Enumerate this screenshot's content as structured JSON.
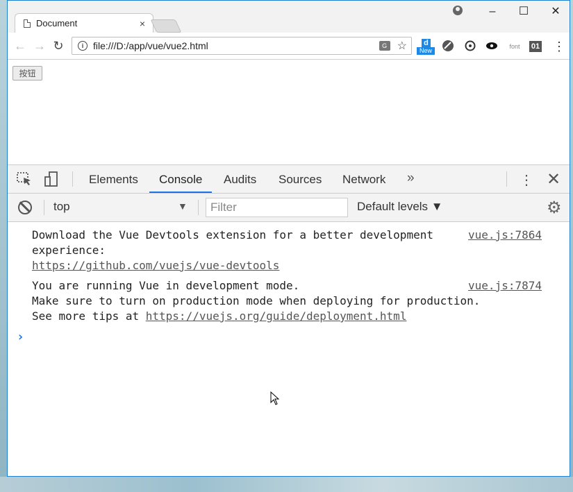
{
  "window": {
    "tab_title": "Document",
    "tab_close": "×",
    "minimize": "–",
    "maximize": "☐",
    "close": "✕"
  },
  "toolbar": {
    "back": "←",
    "forward": "→",
    "reload": "↻",
    "info": "i",
    "url": "file:///D:/app/vue/vue2.html",
    "translate": "G",
    "star": "☆",
    "ext_new_label": "New",
    "ext_d": "d",
    "ext_font": "font",
    "ext_01": "01",
    "menu": "⋮"
  },
  "page": {
    "button_label": "按钮"
  },
  "devtools": {
    "tabs": [
      "Elements",
      "Console",
      "Audits",
      "Sources",
      "Network"
    ],
    "active_tab": "Console",
    "more": "»",
    "kebab": "⋮",
    "close": "✕",
    "context": "top",
    "context_arrow": "▼",
    "filter_placeholder": "Filter",
    "levels": "Default levels ▼",
    "settings": "⚙",
    "messages": [
      {
        "lines": [
          "Download the Vue Devtools extension for a better development",
          "experience:"
        ],
        "link": "https://github.com/vuejs/vue-devtools",
        "source": "vue.js:7864"
      },
      {
        "lines": [
          "You are running Vue in development mode.",
          "Make sure to turn on production mode when deploying for production."
        ],
        "prefix": "See more tips at ",
        "link": "https://vuejs.org/guide/deployment.html",
        "source": "vue.js:7874"
      }
    ],
    "prompt": "›"
  },
  "colors": {
    "accent": "#1a73e8",
    "window_border": "#1e7fd1"
  }
}
